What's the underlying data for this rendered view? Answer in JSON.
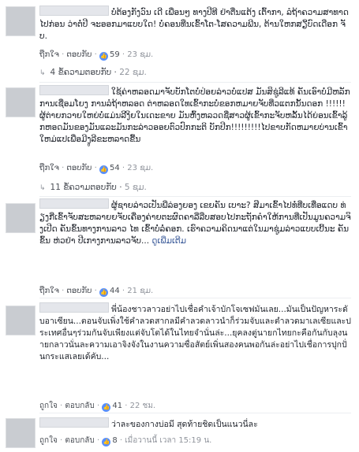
{
  "comments": [
    {
      "text": "ບໍ່ຕ້ອງກັງວົນ ເດີ ເພື່ອນໆ ທາງປີທີ ຢ່າຕື່ນແຕ້ງ ເຕົ້າກາ, ລໍຖ້າຄວາມສາທາດໄປກ່ອນ ວ່າຕໍ່ປີ ຈະອອກມາແບບໃດ! ບໍ່ຄອນທືນເຂົ້າໂຕ-ໂສຄວາມພີນ, ຕ້ານໃຫກສຽິບົດເດືອກ ຈັບ.",
      "see_more": "",
      "like": "ຖືກໃຈ",
      "reply": "ຕອບກັບ",
      "likes": "59",
      "time": "23 ຊມ.",
      "replies_label": "4 ຂໍ້ຄວາມຕອບກັບ",
      "replies_time": "22 ຊມ."
    },
    {
      "text": "ໃຊ້ຄ່າຫລອດມາຈັບບັກໂຕບໍ່ປ່ອຍລ່າວບໍ່ແປສ ມັນສິຊູ່ລີແທ້ ຄັນເອົາບໍ່ມີຫລັກການເຊື່ອມໂຍງ ການລໍຖ້າຫລອດ ຕ່າຫລອດໃທເຂົ້າກະບໍ່ຂອກຫມາຍຈັບທີ່ວແຕກນັ້ນດອກ !!!!!! ຜູ້ຕ່າຍກວາຍໃຫຍ່ບໍ່ແມ່ນລີງິຍໃນເດະຂາຍ ມັນຫົ້ງຫລວດຊື່ສາວຜູ້ເຂົ້າກະຈັບຫລັ້ນໄດ້ຍ່ອນເຂົ້າລູ້ກຫອດມັນຂອງມັນແລະມັນກະລ່າວອອຍຕົວປົກກະຕິ ບັກປີກ!!!!!!!!!ໄປຂາບກັດຫມາຍບ່ານເຂົ້າໃຫມ່ແປເພື່ອມີງູລີຂະຫລາດຂື້ນ",
      "see_more": "",
      "like": "ຖືກໃຈ",
      "reply": "ຕອບກັບ",
      "likes": "54",
      "time": "23 ຊມ.",
      "replies_label": "11 ຂໍ້ຄວາມຕອບກັບ",
      "replies_time": "5 ຊມ."
    },
    {
      "text": "ຜູ້ຊາຍລ່າວເປັນພີ່ລ່ອງຍອງ ເຂຍຄັນ ເບາະ? ສີມາເຂົ້າໄປທໍ່ທີ່ບເທື່ອແດບ ທ່ຽງກີ່ເຂົ້າຈັບສະຫລາຍຍຈັບເຄື່ອງຄ່າຍຕະຜົດຄາລີ່ລືບສອບໄປກະຖັກຄຳໃຫ້ການທີ່ເປັນມູນຄວາມຈິງເປີດ ຄັນຂົ້ນທາງການລາວ ໄທ ເຂົ້າບໍ່ລໍ່ຄອກ. ເຮົາຄວາມຄິດນາແຕ່ໃນມາຊູ່ມລ່າວແບບເບີ້ນະ ຄັນຂົ້ນ ຫ່ວຢ່າ ປີເກາງການລາວຈັບ...",
      "see_more": "ດູເພີ່ມເຕີມ",
      "like": "ຖືກໃຈ",
      "reply": "ຕອບກັບ",
      "likes": "44",
      "time": "21 ຊມ."
    },
    {
      "text": "พี่น้องชาวลาวอย่าไปเชื่อคำเจ้าบักโจเซฟมันเลย...มันเป็นปัญหาระดับอาเซียน...ตอนจับเพิ่งใช้คำลวดสากลมีคำลวดลาวนำก็ร่วมจับและตำลวดมาเลเซียและประเทศอื่นๆร่วมกันจับเพียงแต่จับโตได้ในไทยจำนั่นล่ะ...ยุคลงตู่นายกไทยกะคือกันกับลุงนายกลาวนั่นละความเอาจิงจังในงานความซื่อสัตย์เพิ่นสองคนพอกันล่ะอย่าไปเชื่อการปุกปั่นกระแสเลยเด้คับ...",
      "see_more": "",
      "like": "ถูกใจ",
      "reply": "ตอบกลับ",
      "likes": "41",
      "time": "22 ชม."
    },
    {
      "text": "ว่าละของกางบ่อมี สุดท้ายชิดเป็นแนวนี่ละ",
      "see_more": "",
      "like": "ถูกใจ",
      "reply": "ตอบกลับ",
      "likes": "8",
      "time": "เมื่อวานนี้ เวลา 15:19 น."
    }
  ],
  "icons": {
    "like": "thumbs-up-icon",
    "reply_arrow": "reply-arrow-icon"
  },
  "colors": {
    "link": "#385898",
    "like_badge": "#5890ff",
    "meta": "#90949c"
  }
}
